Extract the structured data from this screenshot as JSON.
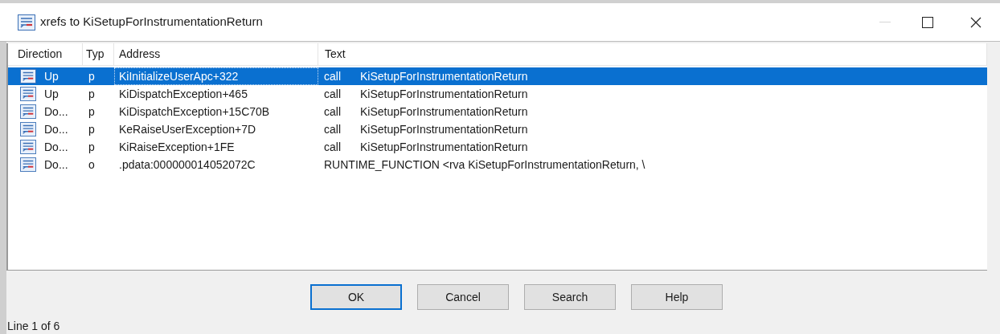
{
  "window": {
    "title": "xrefs to KiSetupForInstrumentationReturn",
    "minimize_disabled": true
  },
  "table": {
    "columns": [
      "Direction",
      "Typ",
      "Address",
      "Text"
    ],
    "rows": [
      {
        "direction": "Up",
        "type": "p",
        "address": "KiInitializeUserApc+322",
        "text": [
          "call",
          "KiSetupForInstrumentationReturn"
        ],
        "selected": true
      },
      {
        "direction": "Up",
        "type": "p",
        "address": "KiDispatchException+465",
        "text": [
          "call",
          "KiSetupForInstrumentationReturn"
        ],
        "selected": false
      },
      {
        "direction": "Do...",
        "type": "p",
        "address": "KiDispatchException+15C70B",
        "text": [
          "call",
          "KiSetupForInstrumentationReturn"
        ],
        "selected": false
      },
      {
        "direction": "Do...",
        "type": "p",
        "address": "KeRaiseUserException+7D",
        "text": [
          "call",
          "KiSetupForInstrumentationReturn"
        ],
        "selected": false
      },
      {
        "direction": "Do...",
        "type": "p",
        "address": "KiRaiseException+1FE",
        "text": [
          "call",
          "KiSetupForInstrumentationReturn"
        ],
        "selected": false
      },
      {
        "direction": "Do...",
        "type": "o",
        "address": ".pdata:000000014052072C",
        "text": [
          "RUNTIME_FUNCTION <rva KiSetupForInstrumentationReturn, \\"
        ],
        "selected": false
      }
    ]
  },
  "buttons": [
    {
      "label": "OK",
      "default": true
    },
    {
      "label": "Cancel",
      "default": false
    },
    {
      "label": "Search",
      "default": false
    },
    {
      "label": "Help",
      "default": false
    }
  ],
  "status_bar": "Line 1 of 6"
}
